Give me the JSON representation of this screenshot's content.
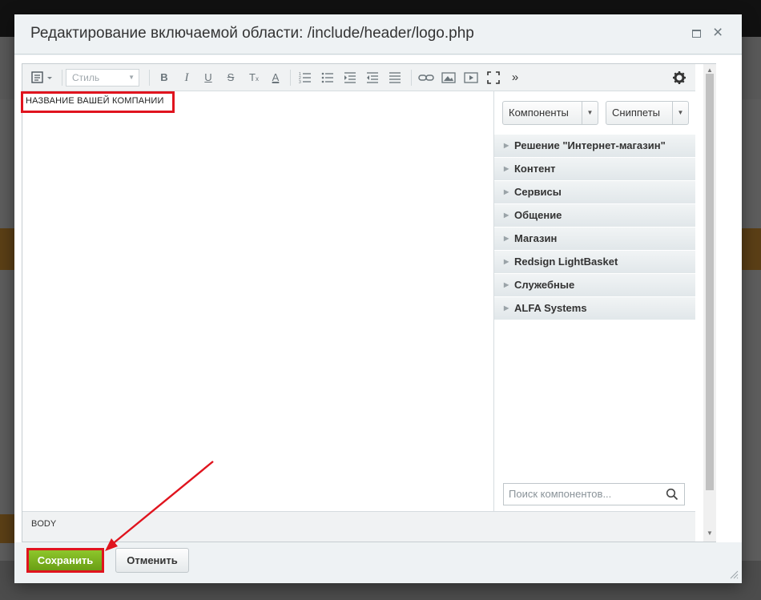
{
  "dialog": {
    "title": "Редактирование включаемой области: /include/header/logo.php"
  },
  "toolbar": {
    "style_select": "Стиль",
    "more": "»"
  },
  "editor": {
    "content_text": "НАЗВАНИЕ ВАШЕЙ КОМПАНИИ",
    "status_path": "BODY"
  },
  "sidepanel": {
    "components_button": "Компоненты",
    "snippets_button": "Сниппеты",
    "categories": [
      {
        "label": "Решение \"Интернет-магазин\""
      },
      {
        "label": "Контент"
      },
      {
        "label": "Сервисы"
      },
      {
        "label": "Общение"
      },
      {
        "label": "Магазин"
      },
      {
        "label": "Redsign LightBasket"
      },
      {
        "label": "Служебные"
      },
      {
        "label": "ALFA Systems"
      }
    ],
    "search_placeholder": "Поиск компонентов..."
  },
  "footer": {
    "save_label": "Сохранить",
    "cancel_label": "Отменить"
  },
  "colors": {
    "highlight_red": "#e0141e",
    "save_green": "#7ab41f",
    "overlay": "#000000"
  }
}
